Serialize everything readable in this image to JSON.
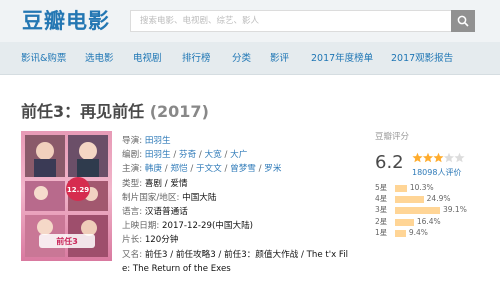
{
  "header": {
    "logo": "豆瓣电影",
    "search_placeholder": "搜索电影、电视剧、综艺、影人"
  },
  "nav": [
    "影讯&购票",
    "选电影",
    "电视剧",
    "排行榜",
    "分类",
    "影评",
    "2017年度榜单",
    "2017观影报告"
  ],
  "movie": {
    "title": "前任3：再见前任",
    "year": "(2017)",
    "info": {
      "director_label": "导演:",
      "director": "田羽生",
      "writer_label": "编剧:",
      "writers": [
        "田羽生",
        "芬奇",
        "大宽",
        "大广"
      ],
      "cast_label": "主演:",
      "cast": [
        "韩庚",
        "郑恺",
        "于文文",
        "曾梦雪",
        "罗米"
      ],
      "genre_label": "类型:",
      "genre": "喜剧 / 爱情",
      "country_label": "制片国家/地区:",
      "country": "中国大陆",
      "language_label": "语言:",
      "language": "汉语普通话",
      "release_label": "上映日期:",
      "release": "2017-12-29(中国大陆)",
      "runtime_label": "片长:",
      "runtime": "120分钟",
      "aka_label": "又名:",
      "aka_line1": "前任3 / 前任攻略3 / 前任3：颜值大作战 / The t'x Fil",
      "aka_line2": "e: The Return of the Exes"
    }
  },
  "rating": {
    "label": "豆瓣评分",
    "score": "6.2",
    "stars": 3,
    "people": "18098人评价",
    "distribution": [
      {
        "label": "5星",
        "pct": "10.3%",
        "value": 10.3
      },
      {
        "label": "4星",
        "pct": "24.9%",
        "value": 24.9
      },
      {
        "label": "3星",
        "pct": "39.1%",
        "value": 39.1
      },
      {
        "label": "2星",
        "pct": "16.4%",
        "value": 16.4
      },
      {
        "label": "1星",
        "pct": "9.4%",
        "value": 9.4
      }
    ]
  },
  "colors": {
    "brand": "#2477b3",
    "link": "#2e7ab8",
    "star": "#ffac2d",
    "bar": "#ffd596"
  }
}
